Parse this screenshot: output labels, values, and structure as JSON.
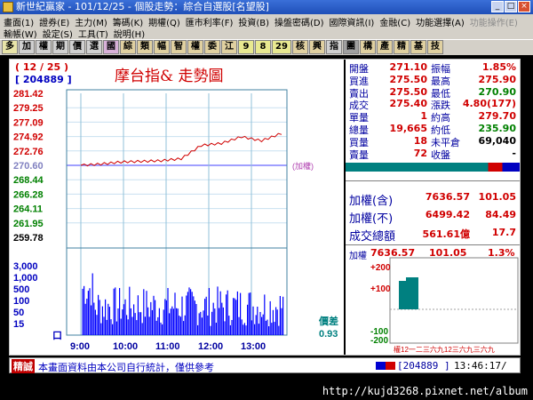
{
  "window": {
    "app_name": "新世紀贏家",
    "title": "新世紀贏家 - 101/12/25 - 個股走勢：綜合自選股[名望股]"
  },
  "menu": {
    "row1": [
      "畫面(1)",
      "證券(E)",
      "主力(M)",
      "籌碼(K)",
      "期權(Q)",
      "匯市利率(F)",
      "投資(B)",
      "操盤密碼(D)",
      "國際資訊(I)",
      "金融(C)",
      "功能選擇(A)",
      "功能操作(E)"
    ],
    "row2": [
      "輸帳(W)",
      "設定(S)",
      "工具(T)",
      "說明(H)"
    ]
  },
  "toolbar": {
    "items": [
      "多",
      "加",
      "權",
      "期",
      "價",
      "選",
      "國",
      "綜",
      "類",
      "幅",
      "智",
      "權",
      "委",
      "江",
      "9",
      "8",
      "29",
      "核",
      "興",
      "指",
      "團",
      "構",
      "產",
      "精",
      "基",
      "技"
    ]
  },
  "chart": {
    "date_label": "( 12 / 25 )",
    "code_label": "[ 204889 ]",
    "title": "摩台指&  走勢圖",
    "ref_label": "(加權)",
    "price_ticks": [
      "281.42",
      "279.25",
      "277.09",
      "274.92",
      "272.76",
      "270.60",
      "268.44",
      "266.28",
      "264.11",
      "261.95",
      "259.78"
    ],
    "volume_ticks": [
      "3,000",
      "1,000",
      "500",
      "100",
      "50",
      "15",
      "口"
    ],
    "time_ticks": [
      "9:00",
      "10:00",
      "11:00",
      "12:00",
      "13:00"
    ],
    "diff_label": "價差",
    "diff_value": "0.93"
  },
  "chart_data": {
    "type": "line",
    "title": "摩台指& 走勢圖",
    "xlabel": "",
    "ylabel": "",
    "x": [
      "9:00",
      "9:30",
      "10:00",
      "10:30",
      "11:00",
      "11:30",
      "11:45",
      "12:00",
      "12:30",
      "13:00",
      "13:30"
    ],
    "series": [
      {
        "name": "",
        "values": [
          270.6,
          270.8,
          271.1,
          271.2,
          271.3,
          271.6,
          273.6,
          273.9,
          274.9,
          274.3,
          275.4
        ]
      }
    ],
    "ylim": [
      259.78,
      281.42
    ],
    "colors": {
      "price": "#d00000",
      "reference": "#8080ff",
      "volume": "#0000ff"
    }
  },
  "quote": {
    "rows": [
      {
        "l1": "開盤",
        "v1": "271.10",
        "l2": "振幅",
        "v2": "1.85%"
      },
      {
        "l1": "買進",
        "v1": "275.50",
        "l2": "最高",
        "v2": "275.90"
      },
      {
        "l1": "賣出",
        "v1": "275.50",
        "l2": "最低",
        "v2": "270.90"
      },
      {
        "l1": "成交",
        "v1": "275.40",
        "l2": "漲跌",
        "v2": "4.80(177)"
      },
      {
        "l1": "單量",
        "v1": "1",
        "l2": "約高",
        "v2": "279.70"
      },
      {
        "l1": "總量",
        "v1": "19,665",
        "l2": "約低",
        "v2": "235.90"
      },
      {
        "l1": "買量",
        "v1": "18",
        "l2": "未平倉",
        "v2": "69,040"
      },
      {
        "l1": "賣量",
        "v1": "72",
        "l2": "收盤",
        "v2": "-"
      }
    ]
  },
  "index": {
    "rows": [
      {
        "label": "加權(含)",
        "value": "7636.57",
        "change": "101.05"
      },
      {
        "label": "加權(不)",
        "value": "6499.42",
        "change": "84.49"
      },
      {
        "label": "成交總額",
        "value": "561.61億",
        "change": "17.7"
      }
    ]
  },
  "mini": {
    "label": "加權",
    "value": "7636.57",
    "change": "101.05",
    "pct": "1.3%",
    "ticks": [
      "+200",
      "+100",
      "-100",
      "-200"
    ],
    "xlabels": "權12一二三六九12三六九三六九"
  },
  "status": {
    "tag": "精誠",
    "message": "本畫面資料由本公司自行統計，僅供參考",
    "code": "[204889 ]",
    "time": "13:46:17/"
  },
  "url": "http://kujd3268.pixnet.net/album"
}
